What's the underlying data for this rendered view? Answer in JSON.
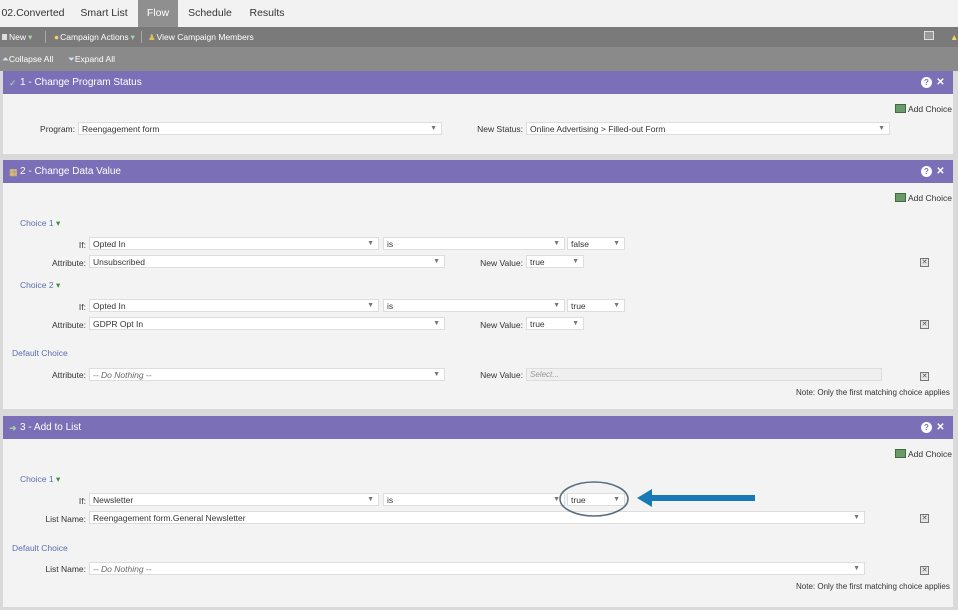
{
  "tabs": [
    {
      "label": "02.Converted",
      "active": false
    },
    {
      "label": "Smart List",
      "active": false
    },
    {
      "label": "Flow",
      "active": true
    },
    {
      "label": "Schedule",
      "active": false
    },
    {
      "label": "Results",
      "active": false
    }
  ],
  "toolbar": {
    "new_label": "New",
    "campaign_actions_label": "Campaign Actions",
    "view_members_label": "View Campaign Members",
    "collapse_all_label": "Collapse All",
    "expand_all_label": "Expand All"
  },
  "add_choice_label": "Add Choice",
  "note_text": "Note: Only the first matching choice applies",
  "step1": {
    "title": "1 - Change Program Status",
    "program_label": "Program:",
    "program_value": "Reengagement form",
    "new_status_label": "New Status:",
    "new_status_value": "Online Advertising > Filled-out Form"
  },
  "step2": {
    "title": "2 - Change Data Value",
    "choice1": {
      "label": "Choice 1",
      "if_label": "If:",
      "field": "Opted In",
      "operator": "is",
      "value": "false",
      "attribute_label": "Attribute:",
      "attribute": "Unsubscribed",
      "new_value_label": "New Value:",
      "new_value": "true"
    },
    "choice2": {
      "label": "Choice 2",
      "if_label": "If:",
      "field": "Opted In",
      "operator": "is",
      "value": "true",
      "attribute_label": "Attribute:",
      "attribute": "GDPR Opt In",
      "new_value_label": "New Value:",
      "new_value": "true"
    },
    "default": {
      "label": "Default Choice",
      "attribute_label": "Attribute:",
      "attribute": "-- Do Nothing --",
      "new_value_label": "New Value:",
      "new_value_placeholder": "Select..."
    }
  },
  "step3": {
    "title": "3 - Add to List",
    "choice1": {
      "label": "Choice 1",
      "if_label": "If:",
      "field": "Newsletter",
      "operator": "is",
      "value": "true",
      "list_label": "List Name:",
      "list": "Reengagement form.General Newsletter"
    },
    "default": {
      "label": "Default Choice",
      "list_label": "List Name:",
      "list": "-- Do Nothing --"
    }
  },
  "annotation": {
    "arrow_color": "#1a7ab8",
    "circle_color": "#5b6e7e"
  },
  "colors": {
    "panel_header": "#7b70b8",
    "choice_link": "#5a6fae"
  }
}
